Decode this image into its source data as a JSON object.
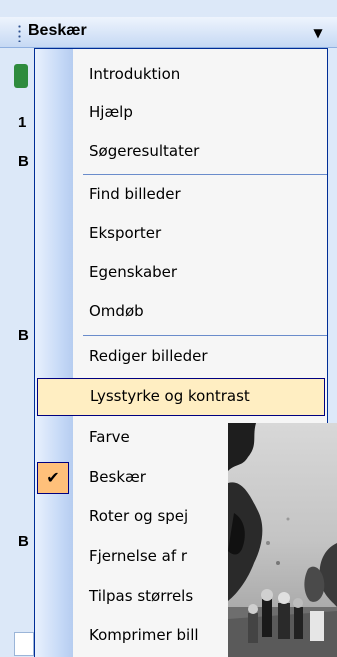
{
  "task_pane": {
    "title": "Beskær",
    "dropdown_icon": "triangle-down-icon",
    "partial_labels": [
      "1",
      "B",
      "B",
      "B"
    ]
  },
  "menu": {
    "items": [
      {
        "label": "Introduktion",
        "checked": false,
        "highlighted": false
      },
      {
        "label": "Hjælp",
        "checked": false,
        "highlighted": false
      },
      {
        "label": "Søgeresultater",
        "checked": false,
        "highlighted": false
      },
      {
        "label": "Find billeder",
        "checked": false,
        "highlighted": false
      },
      {
        "label": "Eksporter",
        "checked": false,
        "highlighted": false
      },
      {
        "label": "Egenskaber",
        "checked": false,
        "highlighted": false
      },
      {
        "label": "Omdøb",
        "checked": false,
        "highlighted": false
      },
      {
        "label": "Rediger billeder",
        "checked": false,
        "highlighted": false
      },
      {
        "label": "Lysstyrke og kontrast",
        "checked": false,
        "highlighted": true
      },
      {
        "label": "Farve",
        "checked": false,
        "highlighted": false
      },
      {
        "label": "Beskær",
        "checked": true,
        "highlighted": false
      },
      {
        "label": "Roter og spej",
        "checked": false,
        "highlighted": false
      },
      {
        "label": "Fjernelse af r",
        "checked": false,
        "highlighted": false
      },
      {
        "label": "Tilpas størrels",
        "checked": false,
        "highlighted": false
      },
      {
        "label": "Komprimer bill",
        "checked": false,
        "highlighted": false
      }
    ],
    "check_icon": "checkmark-icon"
  },
  "colors": {
    "highlight_bg": "#ffeec2",
    "highlight_border": "#000080",
    "checked_bg": "#ffc07a",
    "separator": "#6a8ccb"
  }
}
